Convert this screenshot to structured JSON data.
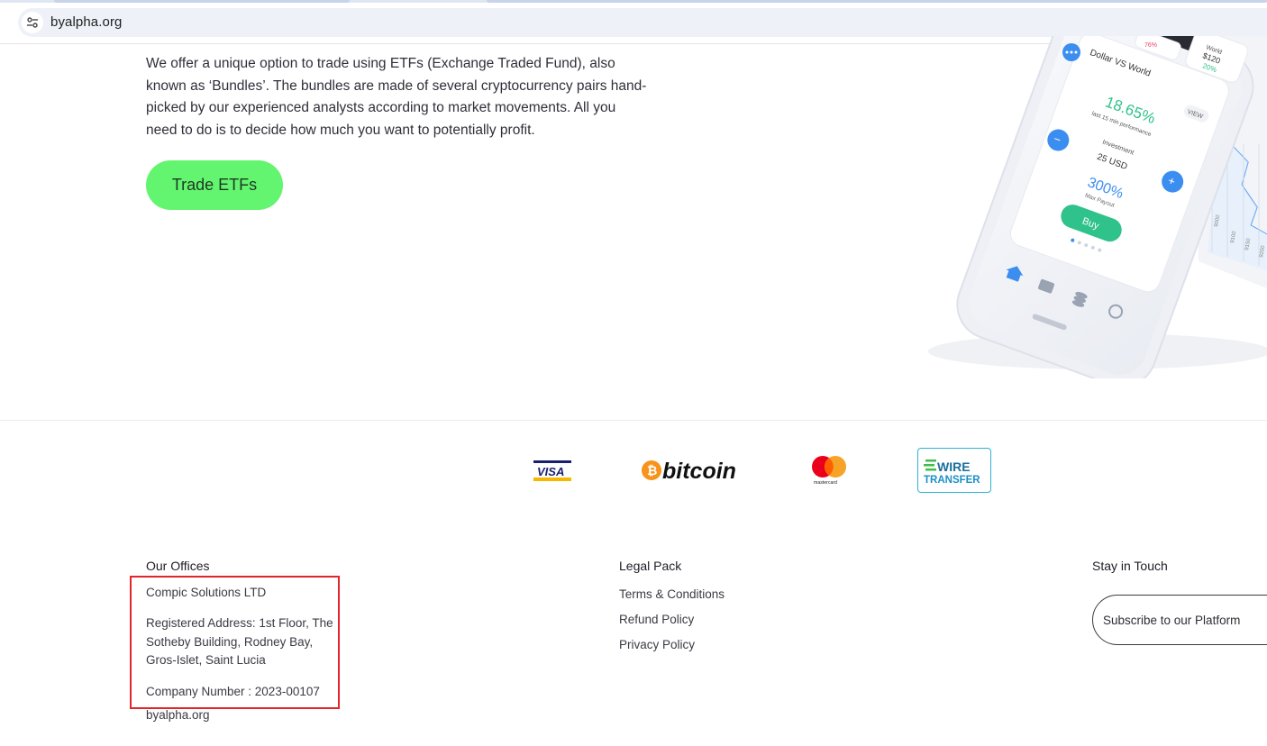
{
  "browser": {
    "url": "byalpha.org"
  },
  "hero": {
    "description": "We offer a unique option to trade using ETFs (Exchange Traded Fund), also known as ‘Bundles’. The bundles are made of several cryptocurrency pairs hand-picked by our experienced analysts according to market movements. All you need to do is to decide how much you want to potentially profit.",
    "cta_label": "Trade ETFs"
  },
  "phone": {
    "card_title": "Dollar VS World",
    "view_label": "VIEW",
    "performance_value": "18.65%",
    "performance_caption": "last 15 min performance",
    "investment_label": "Investment",
    "investment_value": "25 USD",
    "payout_value": "300%",
    "payout_caption": "Max Payout",
    "buy_label": "Buy",
    "top_right_value": "$120",
    "top_right_pct": "20%",
    "top_right_caption": "World",
    "top_center_pct": "76%",
    "minus_label": "−",
    "plus_label": "+",
    "axis_labels": [
      "9000",
      "9100",
      "9150",
      "9200"
    ],
    "colors": {
      "green": "#2fc28a",
      "blue": "#3b8ef0"
    }
  },
  "payments": {
    "visa": "VISA",
    "bitcoin": "bitcoin",
    "mastercard": "mastercard",
    "wire_line1": "WIRE",
    "wire_line2": "TRANSFER"
  },
  "footer": {
    "offices": {
      "title": "Our Offices",
      "company_name": "Compic Solutions LTD",
      "registered_address": "Registered Address: 1st Floor, The Sotheby Building, Rodney Bay, Gros-Islet, Saint Lucia",
      "company_number": "Company Number : 2023-00107",
      "domain": "byalpha.org"
    },
    "legal": {
      "title": "Legal Pack",
      "links": [
        "Terms & Conditions",
        "Refund Policy",
        "Privacy Policy"
      ]
    },
    "touch": {
      "title": "Stay in Touch",
      "subscribe_placeholder": "Subscribe to our Platform"
    }
  },
  "colors": {
    "cta_green": "#63f56f",
    "highlight_red": "#e3242b"
  }
}
